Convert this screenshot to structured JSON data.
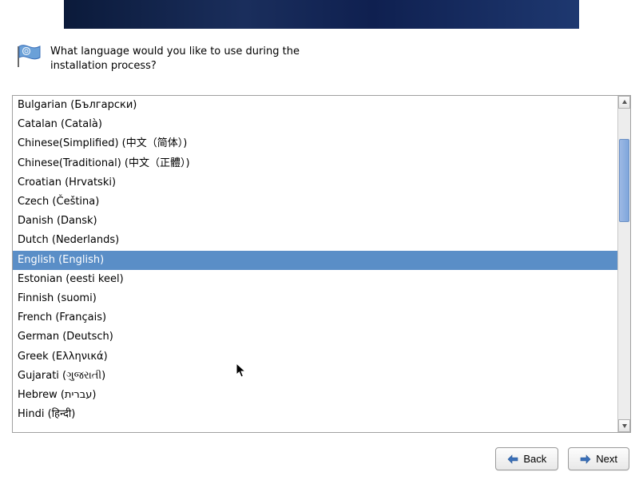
{
  "prompt": "What language would you like to use during the installation process?",
  "selected_index": 8,
  "languages": [
    "Bulgarian (Български)",
    "Catalan (Català)",
    "Chinese(Simplified) (中文（简体）)",
    "Chinese(Traditional) (中文（正體）)",
    "Croatian (Hrvatski)",
    "Czech (Čeština)",
    "Danish (Dansk)",
    "Dutch (Nederlands)",
    "English (English)",
    "Estonian (eesti keel)",
    "Finnish (suomi)",
    "French (Français)",
    "German (Deutsch)",
    "Greek (Ελληνικά)",
    "Gujarati (ગુજરાતી)",
    "Hebrew (עברית)",
    "Hindi (हिन्दी)"
  ],
  "buttons": {
    "back": "Back",
    "next": "Next"
  },
  "colors": {
    "selection": "#5a8ec7",
    "arrow": "#3a6fb8"
  }
}
